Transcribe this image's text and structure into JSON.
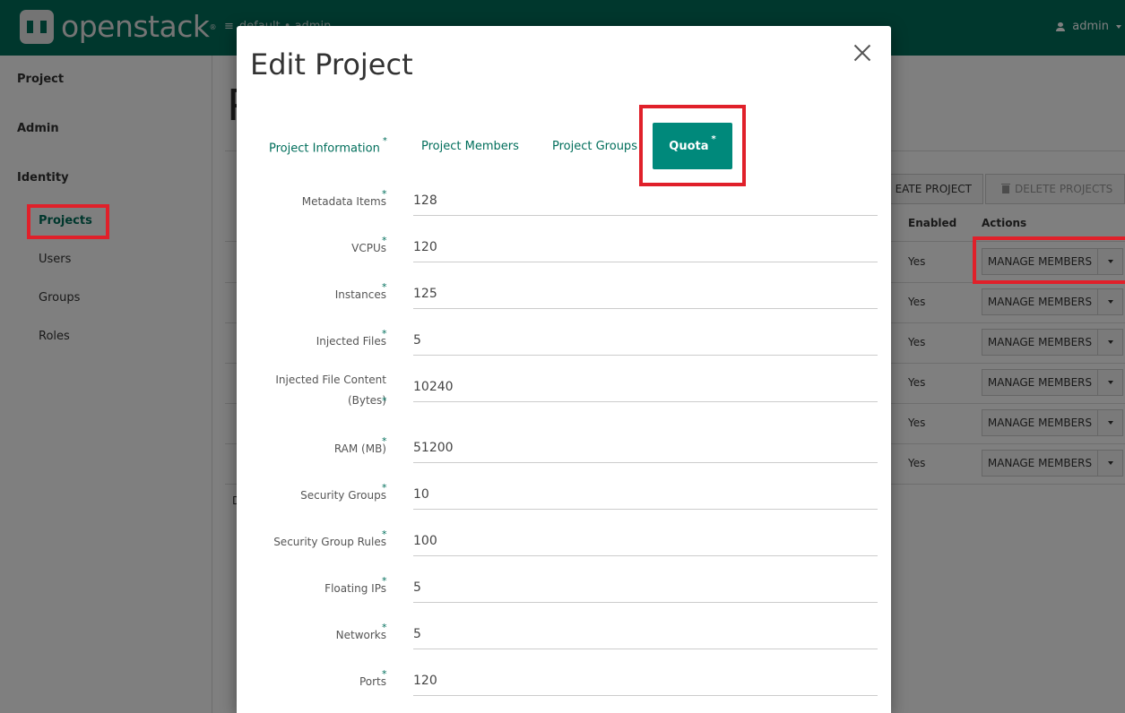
{
  "navbar": {
    "brand": "openstack",
    "context": "default • admin",
    "user": "admin"
  },
  "sidebar": {
    "sections": [
      "Project",
      "Admin",
      "Identity"
    ],
    "items": [
      "Projects",
      "Users",
      "Groups",
      "Roles"
    ]
  },
  "background": {
    "page_title_initial": "P",
    "create_button": "EATE PROJECT",
    "delete_button": "DELETE PROJECTS",
    "columns": {
      "enabled": "Enabled",
      "actions": "Actions"
    },
    "rows": [
      {
        "enabled": "Yes",
        "action": "MANAGE MEMBERS"
      },
      {
        "enabled": "Yes",
        "action": "MANAGE MEMBERS"
      },
      {
        "enabled": "Yes",
        "action": "MANAGE MEMBERS"
      },
      {
        "enabled": "Yes",
        "action": "MANAGE MEMBERS"
      },
      {
        "enabled": "Yes",
        "action": "MANAGE MEMBERS"
      },
      {
        "enabled": "Yes",
        "action": "MANAGE MEMBERS"
      }
    ],
    "footer_initial": "D"
  },
  "modal": {
    "title": "Edit Project",
    "tabs": [
      {
        "label": "Project Information",
        "required": "*"
      },
      {
        "label": "Project Members",
        "required": ""
      },
      {
        "label": "Project Groups",
        "required": ""
      },
      {
        "label": "Quota",
        "required": "*"
      }
    ],
    "fields": [
      {
        "label": "Metadata Items",
        "value": "128"
      },
      {
        "label": "VCPUs",
        "value": "120"
      },
      {
        "label": "Instances",
        "value": "125"
      },
      {
        "label": "Injected Files",
        "value": "5"
      },
      {
        "label": "Injected File Content (Bytes)",
        "value": "10240"
      },
      {
        "label": "RAM (MB)",
        "value": "51200"
      },
      {
        "label": "Security Groups",
        "value": "10"
      },
      {
        "label": "Security Group Rules",
        "value": "100"
      },
      {
        "label": "Floating IPs",
        "value": "5"
      },
      {
        "label": "Networks",
        "value": "5"
      },
      {
        "label": "Ports",
        "value": "120"
      }
    ],
    "required_marker": "*"
  },
  "colors": {
    "brand": "#006e5b",
    "active_tab": "#00897b",
    "highlight": "#e0202a"
  }
}
